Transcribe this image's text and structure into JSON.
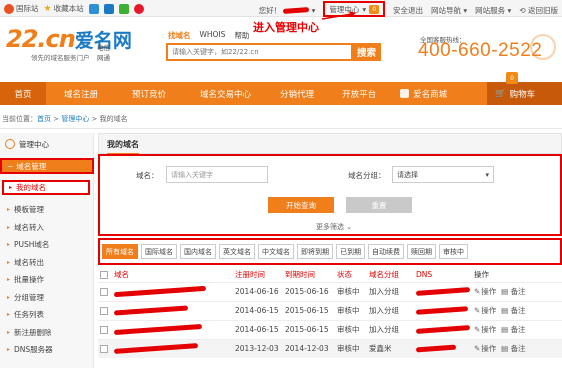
{
  "topbar": {
    "left": [
      {
        "label": "国际站",
        "icon": "globe-icon",
        "color": "#e8501f"
      },
      {
        "label": "收藏本站",
        "icon": "star-icon",
        "color": "#f0a81b"
      }
    ],
    "hello": "您好！",
    "user_menu": "管理中心",
    "msg_count": "0",
    "logout": "安全退出",
    "site_nav": "网站导航",
    "service": "网站服务",
    "old_version": "返回旧版"
  },
  "header": {
    "logo_domain": "22.cn",
    "logo_brand": "爱名网",
    "logo_slogan": "领先的域名服务门户",
    "telecom": [
      "电信",
      "网通"
    ],
    "search_tabs": [
      "找域名",
      "WHOIS",
      "帮助"
    ],
    "search_placeholder": "请输入关键字，如22/22.cn",
    "search_button": "搜索",
    "hotline_label": "全国客服热线：",
    "hotline": "400-660-2522",
    "callout": "进入管理中心"
  },
  "nav": {
    "items": [
      "首页",
      "域名注册",
      "预订竞价",
      "域名交易中心",
      "分销代理",
      "开放平台",
      "爱名商城"
    ],
    "cart_label": "购物车",
    "cart_count": "0"
  },
  "breadcrumb": {
    "prefix": "当前位置：",
    "home": "首页",
    "sep": " > ",
    "center": "管理中心",
    "current": "我的域名"
  },
  "sidebar": {
    "header": "管理中心",
    "group": "域名管理",
    "active": "我的域名",
    "items": [
      "模板管理",
      "域名转入",
      "PUSH域名",
      "域名转出",
      "批量操作",
      "分组管理",
      "任务列表",
      "新注册删除",
      "DNS服务器"
    ]
  },
  "panel": {
    "title": "我的域名",
    "domain_label": "域名：",
    "domain_placeholder": "请输入关键字",
    "group_label": "域名分组：",
    "group_select": "请选择",
    "query_button": "开始查询",
    "reset_button": "重置",
    "more_filter": "更多筛选",
    "status_tabs": [
      "所有域名",
      "国际域名",
      "国内域名",
      "英文域名",
      "中文域名",
      "即将到期",
      "已到期",
      "自动续费",
      "赎回期",
      "审核中"
    ]
  },
  "table": {
    "headers": [
      "域名",
      "注册时间",
      "到期时间",
      "状态",
      "域名分组",
      "DNS",
      "操作"
    ],
    "rows": [
      {
        "reg": "2014-06-16",
        "exp": "2015-06-16",
        "status": "审核中",
        "group": "加入分组",
        "op1": "操作",
        "op2": "备注"
      },
      {
        "reg": "2014-06-15",
        "exp": "2015-06-15",
        "status": "审核中",
        "group": "加入分组",
        "op1": "操作",
        "op2": "备注"
      },
      {
        "reg": "2014-06-15",
        "exp": "2015-06-15",
        "status": "审核中",
        "group": "加入分组",
        "op1": "操作",
        "op2": "备注"
      },
      {
        "reg": "2013-12-03",
        "exp": "2014-12-03",
        "status": "审核中",
        "group": "爱鑫米",
        "op1": "操作",
        "op2": "备注"
      }
    ]
  }
}
